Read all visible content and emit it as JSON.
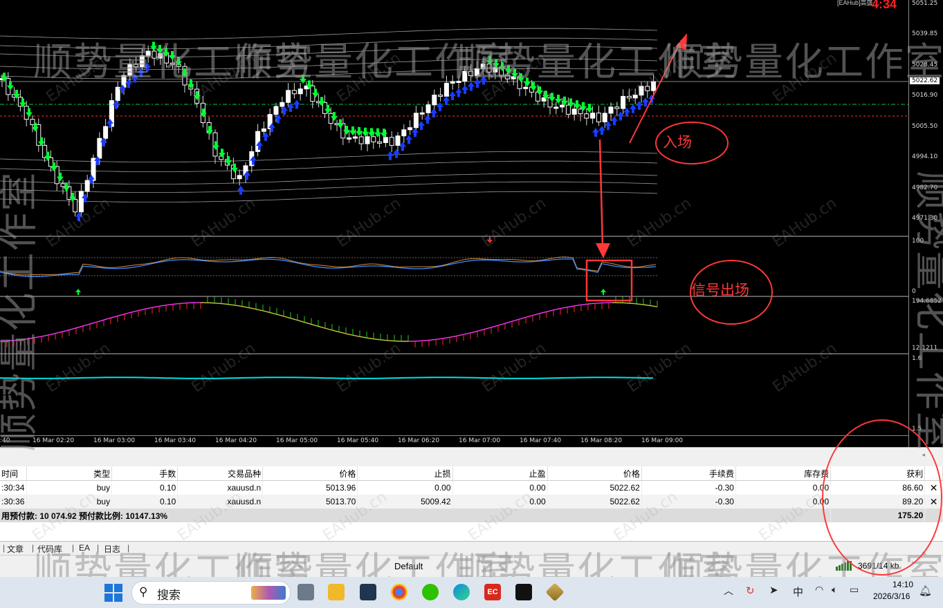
{
  "chart": {
    "corner_title": "[EAHub]高盛 ...",
    "countdown": "4:34",
    "price_levels": [
      "5051.25",
      "5039.85",
      "5028.45",
      "5016.90",
      "5005.50",
      "4994.10",
      "4982.70",
      "4971.30"
    ],
    "current_price": "5022.62",
    "osc1_scale": [
      "100",
      "0"
    ],
    "osc2_scale": [
      "194.6852",
      "12.1211"
    ],
    "osc3_scale": [
      "1.6",
      "1.5"
    ],
    "time_labels": [
      ":40",
      "16 Mar 02:20",
      "16 Mar 03:00",
      "16 Mar 03:40",
      "16 Mar 04:20",
      "16 Mar 05:00",
      "16 Mar 05:40",
      "16 Mar 06:20",
      "16 Mar 07:00",
      "16 Mar 07:40",
      "16 Mar 08:20",
      "16 Mar 09:00"
    ],
    "colors": {
      "bull": "#ffffff",
      "bear_arrow": "#00ff33",
      "bull_arrow": "#1a3cff",
      "cyan": "#00e5e5",
      "magenta": "#ff33ff",
      "annot": "#ff3838"
    }
  },
  "annotations": {
    "entry_label": "入场",
    "signal_exit_label": "信号出场"
  },
  "watermarks": {
    "studio_text": "顺势量化工作室",
    "site_text": "EAHub.cn"
  },
  "orders": {
    "headers": [
      "时间",
      "类型",
      "手数",
      "交易品种",
      "价格",
      "止损",
      "止盈",
      "价格",
      "手续费",
      "库存费",
      "获利"
    ],
    "rows": [
      {
        "time": ":30:34",
        "type": "buy",
        "lots": "0.10",
        "symbol": "xauusd.n",
        "open_price": "5013.96",
        "sl": "0.00",
        "tp": "0.00",
        "price": "5022.62",
        "commission": "-0.30",
        "swap": "0.00",
        "profit": "86.60"
      },
      {
        "time": ":30:36",
        "type": "buy",
        "lots": "0.10",
        "symbol": "xauusd.n",
        "open_price": "5013.70",
        "sl": "5009.42",
        "tp": "0.00",
        "price": "5022.62",
        "commission": "-0.30",
        "swap": "0.00",
        "profit": "89.20"
      }
    ],
    "summary_left": "用预付款: 10 074.92  预付款比例: 10147.13%",
    "summary_total": "175.20"
  },
  "tabs": [
    "文章",
    "代码库",
    "EA",
    "日志"
  ],
  "status": {
    "profile": "Default",
    "traffic": "3691/14 kb"
  },
  "taskbar": {
    "search_placeholder": "搜索",
    "ime": "中",
    "time": "14:10",
    "date": "2026/3/16"
  }
}
